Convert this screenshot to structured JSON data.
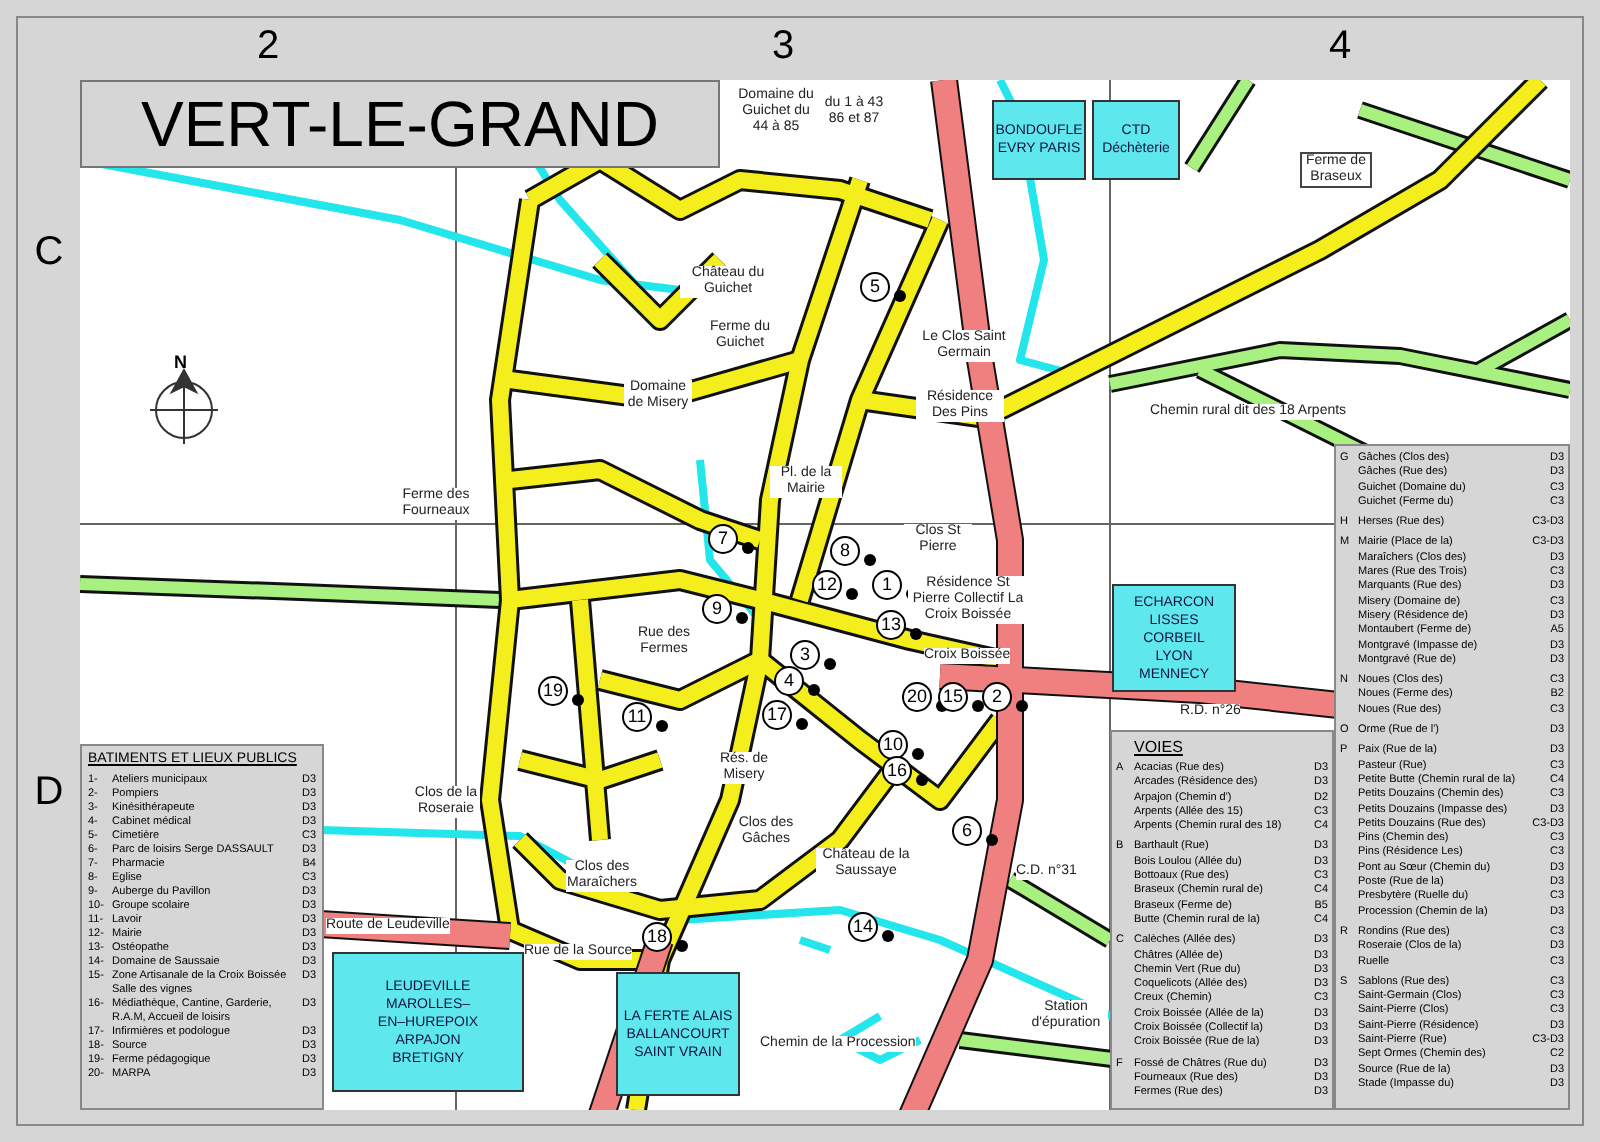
{
  "title": "VERT-LE-GRAND",
  "grid": {
    "columns": [
      "2",
      "3",
      "4"
    ],
    "rows": [
      "C",
      "D"
    ]
  },
  "north_label": "N",
  "map_labels": [
    "Domaine du Guichet du 44 à 85",
    "du 1 à 43 86 et 87",
    "Château du Guichet",
    "Ferme du Guichet",
    "Le Clos Saint Germain",
    "Résidence Des Pins",
    "Domaine de Misery",
    "Pl. de la Mairie",
    "Clos St Pierre",
    "Résidence St Pierre Collectif La Croix Boissée",
    "Ferme des Fourneaux",
    "Rue des Fermes",
    "Rés. de Misery",
    "Clos des Gâches",
    "Château de la Saussaye",
    "Clos des Maraîchers",
    "Clos de la Roseraie",
    "Route de Leudeville",
    "Rue de la Source",
    "Chemin de la Procession",
    "C.D. n°31",
    "Station d'épuration",
    "R.D. n°26",
    "Ferme de Braseux",
    "Chemin rural dit des 18 Arpents",
    "Croix Boissée"
  ],
  "markers": [
    "5",
    "7",
    "8",
    "9",
    "1",
    "12",
    "13",
    "3",
    "4",
    "17",
    "20",
    "15",
    "2",
    "10",
    "16",
    "6",
    "11",
    "19",
    "18",
    "14"
  ],
  "signs": [
    {
      "lines": [
        "BONDOUFLE",
        "EVRY PARIS"
      ]
    },
    {
      "lines": [
        "CTD Déchèterie"
      ]
    },
    {
      "lines": [
        "ECHARCON",
        "LISSES",
        "CORBEIL",
        "LYON",
        "MENNECY"
      ]
    },
    {
      "lines": [
        "LEUDEVILLE",
        "MAROLLES–",
        "EN–HUREPOIX",
        "ARPAJON",
        "BRETIGNY"
      ]
    },
    {
      "lines": [
        "LA FERTE ALAIS",
        "BALLANCOURT",
        "SAINT VRAIN"
      ]
    }
  ],
  "legend": {
    "title": "BATIMENTS ET LIEUX PUBLICS",
    "items": [
      {
        "number": "1-",
        "name": "Ateliers municipaux",
        "ref": "D3"
      },
      {
        "number": "2-",
        "name": "Pompiers",
        "ref": "D3"
      },
      {
        "number": "3-",
        "name": "Kinésithérapeute",
        "ref": "D3"
      },
      {
        "number": "4-",
        "name": "Cabinet médical",
        "ref": "D3"
      },
      {
        "number": "5-",
        "name": "Cimetière",
        "ref": "C3"
      },
      {
        "number": "6-",
        "name": "Parc de loisirs Serge DASSAULT",
        "ref": "D3"
      },
      {
        "number": "7-",
        "name": "Pharmacie",
        "ref": "B4"
      },
      {
        "number": "8-",
        "name": "Eglise",
        "ref": "C3"
      },
      {
        "number": "9-",
        "name": "Auberge du Pavillon",
        "ref": "D3"
      },
      {
        "number": "10-",
        "name": "Groupe scolaire",
        "ref": "D3"
      },
      {
        "number": "11-",
        "name": "Lavoir",
        "ref": "D3"
      },
      {
        "number": "12-",
        "name": "Mairie",
        "ref": "D3"
      },
      {
        "number": "13-",
        "name": "Ostéopathe",
        "ref": "D3"
      },
      {
        "number": "14-",
        "name": "Domaine de Saussaie",
        "ref": "D3"
      },
      {
        "number": "15-",
        "name": "Zone Artisanale de la Croix Boissée Salle des vignes",
        "ref": "D3"
      },
      {
        "number": "16-",
        "name": "Médiathèque, Cantine, Garderie, R.A.M, Accueil de loisirs",
        "ref": "D3"
      },
      {
        "number": "17-",
        "name": "Infirmières et podologue",
        "ref": "D3"
      },
      {
        "number": "18-",
        "name": "Source",
        "ref": "D3"
      },
      {
        "number": "19-",
        "name": "Ferme pédagogique",
        "ref": "D3"
      },
      {
        "number": "20-",
        "name": "MARPA",
        "ref": "D3"
      }
    ]
  },
  "street_index": {
    "heading": "VOIES",
    "left_groups": [
      {
        "letter": "A",
        "entries": [
          {
            "name": "Acacias (Rue des)",
            "ref": "D3"
          },
          {
            "name": "Arcades (Résidence des)",
            "ref": "D3"
          },
          {
            "name": "Arpajon (Chemin d')",
            "ref": "D2"
          },
          {
            "name": "Arpents (Allée des 15)",
            "ref": "C3"
          },
          {
            "name": "Arpents (Chemin rural des 18)",
            "ref": "C4"
          }
        ]
      },
      {
        "letter": "B",
        "entries": [
          {
            "name": "Barthault (Rue)",
            "ref": "D3"
          },
          {
            "name": "Bois Loulou (Allée du)",
            "ref": "D3"
          },
          {
            "name": "Bottoaux (Rue des)",
            "ref": "C3"
          },
          {
            "name": "Braseux (Chemin rural de)",
            "ref": "C4"
          },
          {
            "name": "Braseux (Ferme de)",
            "ref": "B5"
          },
          {
            "name": "Butte (Chemin rural de la)",
            "ref": "C4"
          }
        ]
      },
      {
        "letter": "C",
        "entries": [
          {
            "name": "Calèches (Allée des)",
            "ref": "D3"
          },
          {
            "name": "Châtres (Allée de)",
            "ref": "D3"
          },
          {
            "name": "Chemin Vert (Rue du)",
            "ref": "D3"
          },
          {
            "name": "Coquelicots (Allée des)",
            "ref": "D3"
          },
          {
            "name": "Creux (Chemin)",
            "ref": "C3"
          },
          {
            "name": "Croix Boissée (Allée de la)",
            "ref": "D3"
          },
          {
            "name": "Croix Boissée (Collectif la)",
            "ref": "D3"
          },
          {
            "name": "Croix Boissée (Rue de la)",
            "ref": "D3"
          }
        ]
      },
      {
        "letter": "F",
        "entries": [
          {
            "name": "Fossé de Châtres (Rue du)",
            "ref": "D3"
          },
          {
            "name": "Fourneaux (Rue des)",
            "ref": "D3"
          },
          {
            "name": "Fermes (Rue des)",
            "ref": "D3"
          }
        ]
      }
    ],
    "right_groups": [
      {
        "letter": "G",
        "entries": [
          {
            "name": "Gâches (Clos des)",
            "ref": "D3"
          },
          {
            "name": "Gâches (Rue des)",
            "ref": "D3"
          },
          {
            "name": "Guichet (Domaine du)",
            "ref": "C3"
          },
          {
            "name": "Guichet (Ferme du)",
            "ref": "C3"
          }
        ]
      },
      {
        "letter": "H",
        "entries": [
          {
            "name": "Herses (Rue des)",
            "ref": "C3-D3"
          }
        ]
      },
      {
        "letter": "M",
        "entries": [
          {
            "name": "Mairie (Place de la)",
            "ref": "C3-D3"
          },
          {
            "name": "Maraîchers (Clos des)",
            "ref": "D3"
          },
          {
            "name": "Mares (Rue des Trois)",
            "ref": "C3"
          },
          {
            "name": "Marquants (Rue des)",
            "ref": "D3"
          },
          {
            "name": "Misery (Domaine de)",
            "ref": "C3"
          },
          {
            "name": "Misery (Résidence de)",
            "ref": "D3"
          },
          {
            "name": "Montaubert (Ferme de)",
            "ref": "A5"
          },
          {
            "name": "Montgravé (Impasse de)",
            "ref": "D3"
          },
          {
            "name": "Montgravé (Rue de)",
            "ref": "D3"
          }
        ]
      },
      {
        "letter": "N",
        "entries": [
          {
            "name": "Noues (Clos des)",
            "ref": "C3"
          },
          {
            "name": "Noues (Ferme des)",
            "ref": "B2"
          },
          {
            "name": "Noues (Rue des)",
            "ref": "C3"
          }
        ]
      },
      {
        "letter": "O",
        "entries": [
          {
            "name": "Orme (Rue de l')",
            "ref": "D3"
          }
        ]
      },
      {
        "letter": "P",
        "entries": [
          {
            "name": "Paix (Rue de la)",
            "ref": "D3"
          },
          {
            "name": "Pasteur (Rue)",
            "ref": "C3"
          },
          {
            "name": "Petite Butte (Chemin rural de la)",
            "ref": "C4"
          },
          {
            "name": "Petits Douzains (Chemin des)",
            "ref": "C3"
          },
          {
            "name": "Petits Douzains (Impasse des)",
            "ref": "D3"
          },
          {
            "name": "Petits Douzains (Rue des)",
            "ref": "C3-D3"
          },
          {
            "name": "Pins (Chemin des)",
            "ref": "C3"
          },
          {
            "name": "Pins (Résidence Les)",
            "ref": "C3"
          },
          {
            "name": "Pont au Sœur (Chemin du)",
            "ref": "D3"
          },
          {
            "name": "Poste (Rue de la)",
            "ref": "D3"
          },
          {
            "name": "Presbytère (Ruelle du)",
            "ref": "C3"
          },
          {
            "name": "Procession (Chemin de la)",
            "ref": "D3"
          }
        ]
      },
      {
        "letter": "R",
        "entries": [
          {
            "name": "Rondins (Rue des)",
            "ref": "C3"
          },
          {
            "name": "Roseraie (Clos de la)",
            "ref": "D3"
          },
          {
            "name": "Ruelle",
            "ref": "C3"
          }
        ]
      },
      {
        "letter": "S",
        "entries": [
          {
            "name": "Sablons (Rue des)",
            "ref": "C3"
          },
          {
            "name": "Saint-Germain (Clos)",
            "ref": "C3"
          },
          {
            "name": "Saint-Pierre (Clos)",
            "ref": "C3"
          },
          {
            "name": "Saint-Pierre (Résidence)",
            "ref": "D3"
          },
          {
            "name": "Saint-Pierre (Rue)",
            "ref": "C3-D3"
          },
          {
            "name": "Sept Ormes (Chemin des)",
            "ref": "C2"
          },
          {
            "name": "Source (Rue de la)",
            "ref": "D3"
          },
          {
            "name": "Stade (Impasse du)",
            "ref": "D3"
          }
        ]
      }
    ]
  }
}
